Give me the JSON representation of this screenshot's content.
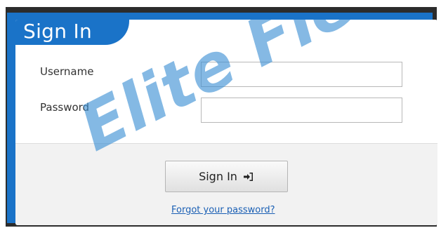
{
  "header": {
    "title": "Sign In"
  },
  "form": {
    "username_label": "Username",
    "username_value": "",
    "password_label": "Password",
    "password_value": ""
  },
  "actions": {
    "signin_label": "Sign In",
    "signin_icon": "sign-in-icon",
    "forgot_label": "Forgot your password?"
  },
  "watermark": {
    "text": "Elite Field"
  },
  "colors": {
    "accent": "#1a73c8",
    "link": "#1a5fb4",
    "watermark": "#3a8fd4",
    "footer_bg": "#f2f2f2"
  }
}
